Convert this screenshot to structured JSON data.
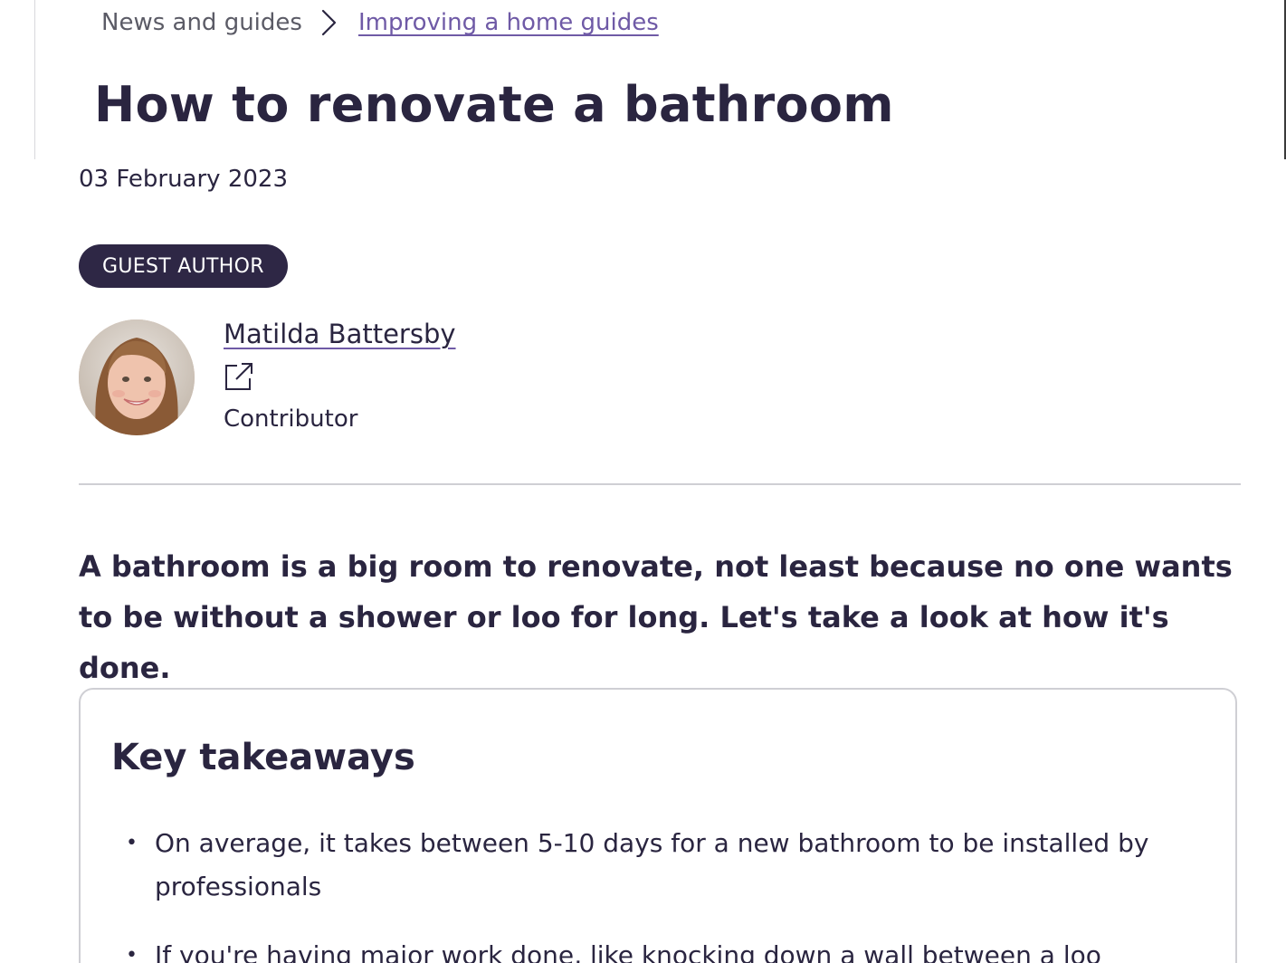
{
  "breadcrumb": {
    "home_label": "News and guides",
    "current_label": "Improving a home guides"
  },
  "article": {
    "title": "How to renovate a bathroom",
    "date": "03 February 2023",
    "badge": "GUEST AUTHOR",
    "author": {
      "name": "Matilda Battersby",
      "role": "Contributor"
    },
    "intro": "A bathroom is a big room to renovate, not least because no one wants to be without a shower or loo for long. Let's take a look at how it's done."
  },
  "takeaways": {
    "heading": "Key takeaways",
    "items": [
      {
        "text": "On average, it takes between 5-10 days for a new bathroom to be installed by professionals"
      },
      {
        "text": "If you're having major work done, like knocking down a wall between a loo"
      }
    ]
  },
  "colors": {
    "text": "#2a2540",
    "link_accent": "#6f5aa6",
    "badge_bg": "#2e2745",
    "border": "#cfcfd4"
  },
  "icons": {
    "breadcrumb_separator": "chevron-right-icon",
    "author_link": "external-link-icon"
  }
}
